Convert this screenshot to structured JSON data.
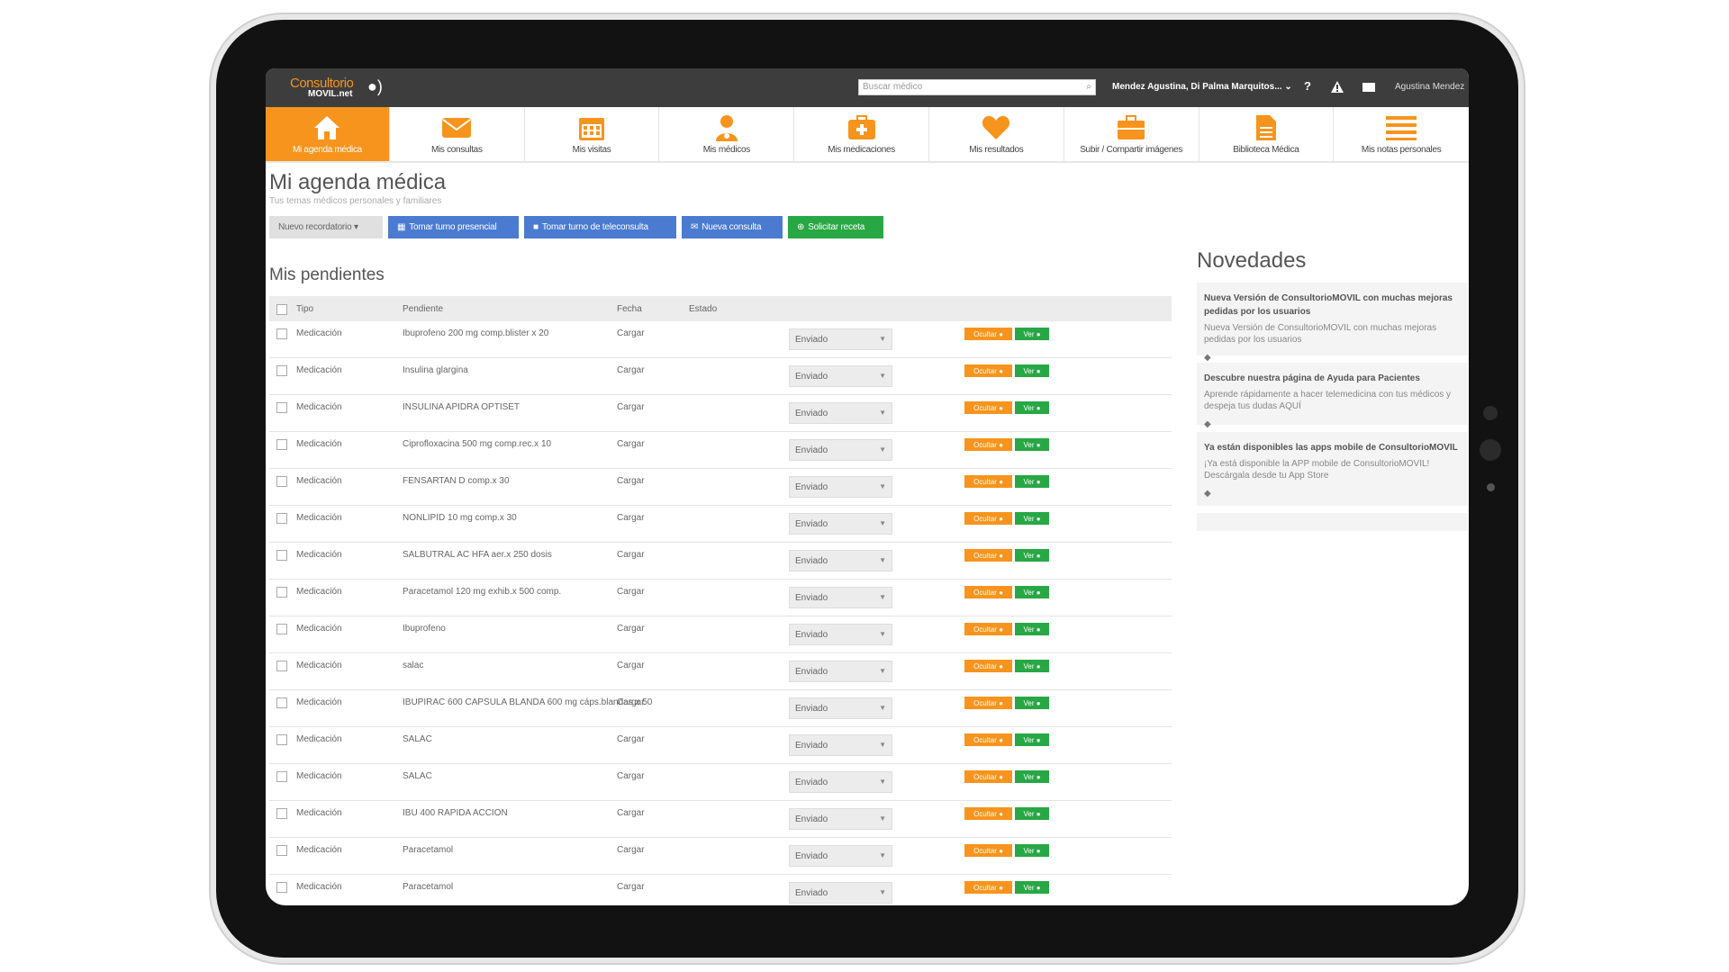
{
  "app": {
    "logo_line1": "Consultorio",
    "logo_line2": "MOVIL.net",
    "search_placeholder": "Buscar médico",
    "patients_selector": "Mendez Agustina, Di Palma Marquitos... ⌄",
    "help_label": "?",
    "user_name": "Agustina Mendez"
  },
  "nav": [
    {
      "label": "Mi agenda médica",
      "icon": "home-icon",
      "active": true
    },
    {
      "label": "Mis consultas",
      "icon": "envelope-icon"
    },
    {
      "label": "Mis visitas",
      "icon": "calendar-icon"
    },
    {
      "label": "Mis médicos",
      "icon": "doctor-icon"
    },
    {
      "label": "Mis medicaciones",
      "icon": "medkit-icon"
    },
    {
      "label": "Mis resultados",
      "icon": "heart-icon"
    },
    {
      "label": "Subir / Compartir imágenes",
      "icon": "briefcase-icon"
    },
    {
      "label": "Biblioteca Médica",
      "icon": "document-icon"
    },
    {
      "label": "Mis notas personales",
      "icon": "menu-lines-icon"
    }
  ],
  "page": {
    "title": "Mi agenda médica",
    "subtitle": "Tus temas médicos personales y familiares",
    "buttons": {
      "reminder": "Nuevo recordatorio ▾",
      "in_person": "Tomar turno presencial",
      "teleconsult": "Tomar turno de teleconsulta",
      "new_consult": "Nueva consulta",
      "prescription": "Solicitar receta"
    }
  },
  "pending": {
    "title": "Mis pendientes",
    "columns": {
      "tipo": "Tipo",
      "pendiente": "Pendiente",
      "fecha": "Fecha",
      "estado": "Estado"
    },
    "hide_label": "Ocultar ●",
    "view_label": "Ver ●",
    "rows": [
      {
        "tipo": "Medicación",
        "pendiente": "Ibuprofeno 200 mg comp.blister x 20",
        "fecha": "Cargar",
        "estado": "Enviado"
      },
      {
        "tipo": "Medicación",
        "pendiente": "Insulina glargina",
        "fecha": "Cargar",
        "estado": "Enviado"
      },
      {
        "tipo": "Medicación",
        "pendiente": "INSULINA APIDRA OPTISET",
        "fecha": "Cargar",
        "estado": "Enviado"
      },
      {
        "tipo": "Medicación",
        "pendiente": "Ciprofloxacina 500 mg comp.rec.x 10",
        "fecha": "Cargar",
        "estado": "Enviado"
      },
      {
        "tipo": "Medicación",
        "pendiente": "FENSARTAN D comp.x 30",
        "fecha": "Cargar",
        "estado": "Enviado"
      },
      {
        "tipo": "Medicación",
        "pendiente": "NONLIPID 10 mg comp.x 30",
        "fecha": "Cargar",
        "estado": "Enviado"
      },
      {
        "tipo": "Medicación",
        "pendiente": "SALBUTRAL AC HFA aer.x 250 dosis",
        "fecha": "Cargar",
        "estado": "Enviado"
      },
      {
        "tipo": "Medicación",
        "pendiente": "Paracetamol 120 mg exhib.x 500 comp.",
        "fecha": "Cargar",
        "estado": "Enviado"
      },
      {
        "tipo": "Medicación",
        "pendiente": "Ibuprofeno",
        "fecha": "Cargar",
        "estado": "Enviado"
      },
      {
        "tipo": "Medicación",
        "pendiente": "salac",
        "fecha": "Cargar",
        "estado": "Enviado"
      },
      {
        "tipo": "Medicación",
        "pendiente": "IBUPIRAC 600 CAPSULA BLANDA 600 mg cáps.blandas x 50",
        "fecha": "Cargar",
        "estado": "Enviado"
      },
      {
        "tipo": "Medicación",
        "pendiente": "SALAC",
        "fecha": "Cargar",
        "estado": "Enviado"
      },
      {
        "tipo": "Medicación",
        "pendiente": "SALAC",
        "fecha": "Cargar",
        "estado": "Enviado"
      },
      {
        "tipo": "Medicación",
        "pendiente": "IBU 400 RAPIDA ACCION",
        "fecha": "Cargar",
        "estado": "Enviado"
      },
      {
        "tipo": "Medicación",
        "pendiente": "Paracetamol",
        "fecha": "Cargar",
        "estado": "Enviado"
      },
      {
        "tipo": "Medicación",
        "pendiente": "Paracetamol",
        "fecha": "Cargar",
        "estado": "Enviado"
      }
    ]
  },
  "news": {
    "title": "Novedades",
    "items": [
      {
        "title": "Nueva Versión de ConsultorioMOVIL con muchas mejoras pedidas por los usuarios",
        "desc": "Nueva Versión de ConsultorioMOVIL con muchas mejoras pedidas por los usuarios"
      },
      {
        "title": "Descubre nuestra página de Ayuda para Pacientes",
        "desc": "Aprende rápidamente a hacer telemedicina con tus médicos y despeja tus dudas AQUÍ"
      },
      {
        "title": "Ya están disponibles las apps mobile de ConsultorioMOVIL",
        "desc": "¡Ya está disponible la APP mobile de ConsultorioMOVIL! Descárgala desde tu App Store"
      }
    ]
  },
  "colors": {
    "accent": "#f7941d",
    "topbar": "#3d3d3d",
    "blue": "#4a7bd1",
    "green": "#28a745"
  }
}
